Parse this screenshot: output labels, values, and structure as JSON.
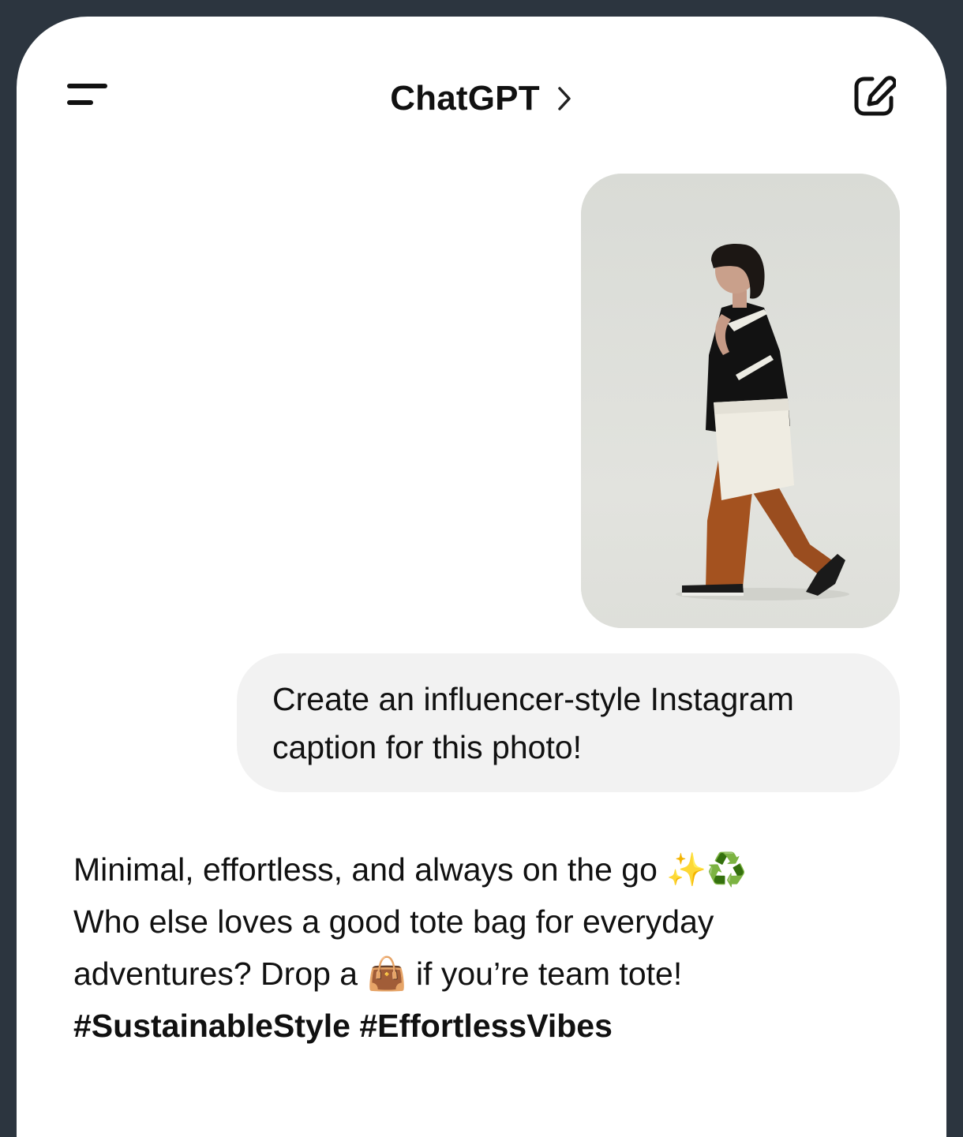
{
  "header": {
    "title": "ChatGPT",
    "menu_icon": "menu-icon",
    "chevron_icon": "chevron-right-icon",
    "new_chat_icon": "edit-icon"
  },
  "conversation": {
    "user_image": {
      "alt": "Person walking with a canvas tote bag, wearing a black t-shirt and brown wide-leg pants"
    },
    "user_message": "Create an influencer-style Instagram caption for this photo!",
    "assistant_message": {
      "line1": "Minimal, effortless, and always on the go ✨♻️",
      "line2": "Who else loves a good tote bag for everyday",
      "line3": "adventures? Drop a 👜 if you’re team tote!",
      "hashtags": "#SustainableStyle #EffortlessVibes"
    }
  },
  "colors": {
    "frame": "#2c353f",
    "screen": "#ffffff",
    "user_bubble": "#f2f2f2",
    "text": "#111111"
  }
}
